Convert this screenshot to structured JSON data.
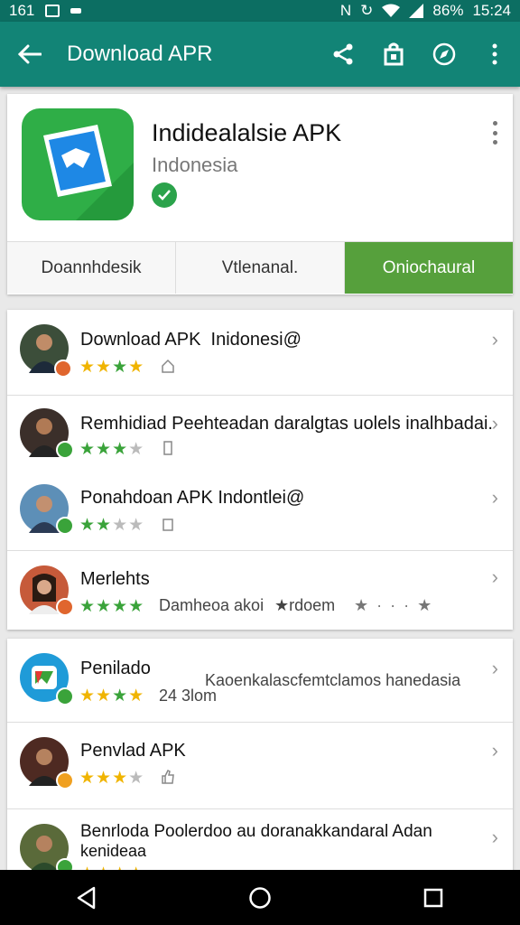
{
  "status_bar": {
    "left_number": "161",
    "battery": "86%",
    "time": "15:24"
  },
  "app_bar": {
    "title": "Download APR",
    "icons": [
      "back-arrow-icon",
      "share-icon",
      "bag-icon",
      "compass-icon",
      "overflow-menu-icon"
    ]
  },
  "hero": {
    "app_name": "Indidealalsie APK",
    "country": "Indonesia",
    "tabs": [
      {
        "label": "Doannhdesik",
        "active": false
      },
      {
        "label": "Vtlenanal.",
        "active": false
      },
      {
        "label": "Oniochaural",
        "active": true
      }
    ]
  },
  "list": [
    {
      "name": "Download APK",
      "name2": "Inidonesi@",
      "rating": 4,
      "total": 4
    },
    {
      "name": "Remhidiad Peehteadan daralgtas uolels inalhbadai.",
      "rating": 3,
      "total": 4
    },
    {
      "name": "Ponahdoan APK Indontlei@",
      "rating": 2,
      "total": 4
    },
    {
      "name": "Merlehts",
      "rating": 4,
      "total": 4,
      "meta": "Damheoa akoi",
      "meta2": "★rdoem",
      "meta3": "★ · · · ★"
    }
  ],
  "list2": [
    {
      "name": "Penilado",
      "rating": 4,
      "total": 4,
      "meta": "24 3lom",
      "desc": "Kaoenkalascfemtclamos hanedasia"
    },
    {
      "name": "Penvlad APK",
      "rating": 3,
      "total": 4
    },
    {
      "name": "Benrloda Poolerdoo au doranakkandaral Adan",
      "name2": "kenideaa",
      "rating": 4,
      "total": 4
    }
  ],
  "colors": {
    "status_bar": "#0c6e62",
    "app_bar": "#128476",
    "accent_green": "#56a03c",
    "star_yellow": "#f0b400",
    "star_green": "#3aa33a"
  }
}
